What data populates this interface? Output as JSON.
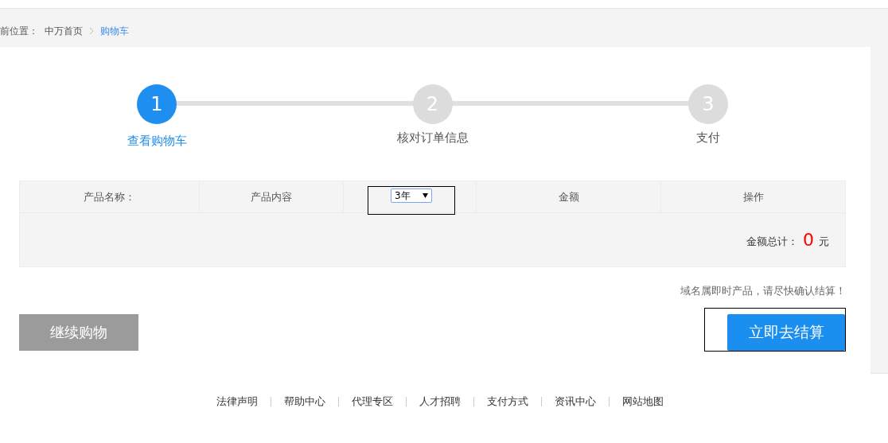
{
  "breadcrumb": {
    "label": "前位置：",
    "items": [
      {
        "text": "中万首页",
        "selected": false
      },
      {
        "text": "购物车",
        "selected": true
      }
    ]
  },
  "steps": [
    {
      "number": "1",
      "label": "查看购物车",
      "selected": true
    },
    {
      "number": "2",
      "label": "核对订单信息",
      "selected": false
    },
    {
      "number": "3",
      "label": "支付",
      "selected": false
    }
  ],
  "table": {
    "columns": [
      {
        "kind": "text",
        "label": "产品名称："
      },
      {
        "kind": "text",
        "label": "产品内容"
      },
      {
        "kind": "select",
        "value": "3年"
      },
      {
        "kind": "text",
        "label": "金额"
      },
      {
        "kind": "text",
        "label": "操作"
      }
    ],
    "total_label": "金额总计：",
    "total_value": "0",
    "total_unit": "元"
  },
  "notice": "域名属即时产品，请尽快确认结算！",
  "buttons": {
    "continue": "继续购物",
    "checkout": "立即去结算"
  },
  "footer_links": [
    "法律声明",
    "帮助中心",
    "代理专区",
    "人才招聘",
    "支付方式",
    "资讯中心",
    "网站地图"
  ]
}
